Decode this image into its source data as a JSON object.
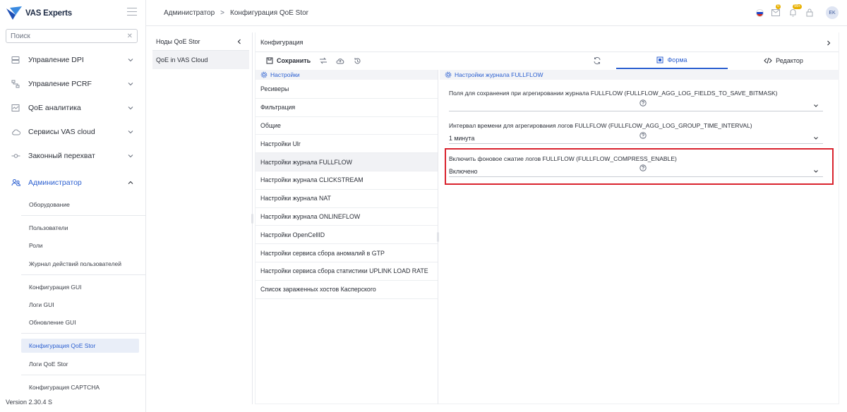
{
  "app": {
    "brand": "VAS Experts",
    "version": "Version 2.30.4 S"
  },
  "search": {
    "placeholder": "Поиск",
    "clear_icon": "close-icon"
  },
  "sidebar": {
    "items": [
      {
        "label": "Управление DPI",
        "icon": "server-icon"
      },
      {
        "label": "Управление PCRF",
        "icon": "policy-icon"
      },
      {
        "label": "QoE аналитика",
        "icon": "chart-icon"
      },
      {
        "label": "Сервисы VAS cloud",
        "icon": "cloud-icon"
      },
      {
        "label": "Законный перехват",
        "icon": "intercept-icon"
      },
      {
        "label": "Администратор",
        "icon": "users-icon",
        "active": true
      }
    ],
    "subitems": [
      "Оборудование",
      "Пользователи",
      "Роли",
      "Журнал действий пользователей",
      "Конфигурация GUI",
      "Логи GUI",
      "Обновление GUI",
      "Конфигурация QoE Stor",
      "Логи QoE Stor",
      "Конфигурация CAPTCHA"
    ],
    "selected_subitem": "Конфигурация QoE Stor"
  },
  "header": {
    "breadcrumb": [
      "Администратор",
      "Конфигурация QoE Stor"
    ],
    "separator": ">",
    "notif_badge": "0",
    "alerts_badge": "99+",
    "avatar": "EK"
  },
  "nodes": {
    "title": "Ноды QoE Stor",
    "items": [
      "QoE in VAS Cloud"
    ]
  },
  "config": {
    "title": "Конфигурация",
    "save_label": "Сохранить",
    "tabs": {
      "form": "Форма",
      "editor": "Редактор"
    },
    "settings_title": "Настройки",
    "section_title": "Настройки журнала FULLFLOW",
    "settings": [
      "Ресиверы",
      "Фильтрация",
      "Общие",
      "Настройки Ulr",
      "Настройки журнала FULLFLOW",
      "Настройки журнала CLICKSTREAM",
      "Настройки журнала NAT",
      "Настройки журнала ONLINEFLOW",
      "Настройки OpenCellID",
      "Настройки сервиса сбора аномалий в GTP",
      "Настройки сервиса сбора статистики UPLINK LOAD RATE",
      "Список зараженных хостов Касперского"
    ],
    "active_setting": "Настройки журнала FULLFLOW",
    "fields": [
      {
        "label": "Поля для сохранения при агрегировании журнала FULLFLOW (FULLFLOW_AGG_LOG_FIELDS_TO_SAVE_BITMASK)",
        "value": ""
      },
      {
        "label": "Интервал времени для агрегирования логов FULLFLOW (FULLFLOW_AGG_LOG_GROUP_TIME_INTERVAL)",
        "value": "1 минута"
      },
      {
        "label": "Включить фоновое сжатие логов FULLFLOW (FULLFLOW_COMPRESS_ENABLE)",
        "value": "Включено"
      }
    ]
  },
  "colors": {
    "accent": "#2b5fd0",
    "highlight": "#d9232e",
    "badge": "#e8b000"
  }
}
